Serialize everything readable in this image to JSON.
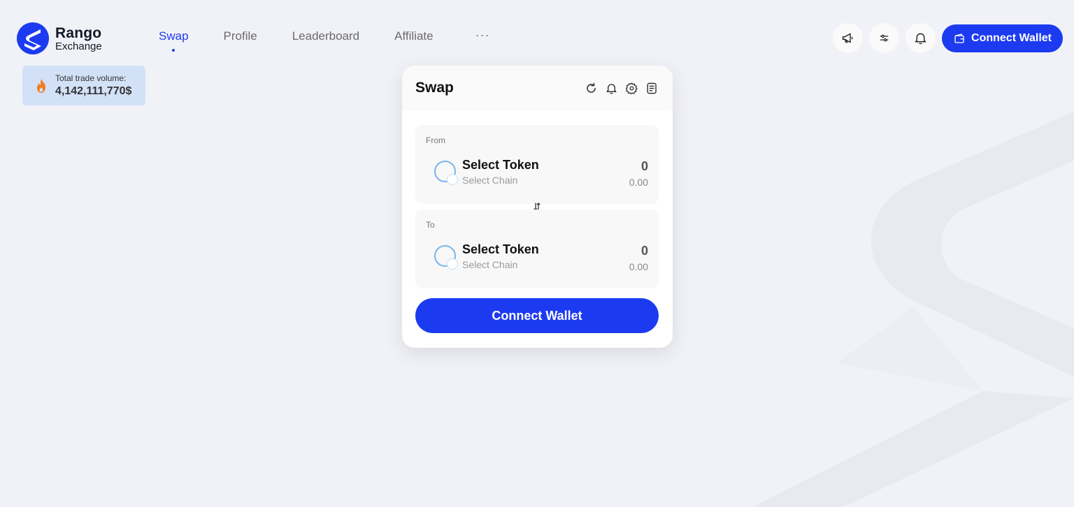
{
  "logo": {
    "name": "Rango",
    "sub": "Exchange"
  },
  "nav": {
    "items": [
      {
        "label": "Swap"
      },
      {
        "label": "Profile"
      },
      {
        "label": "Leaderboard"
      },
      {
        "label": "Affiliate"
      }
    ],
    "more": "···",
    "active": "Swap"
  },
  "header": {
    "connect_label": "Connect Wallet",
    "icons": [
      "megaphone-icon",
      "settings-sliders-icon",
      "bell-icon"
    ]
  },
  "volume": {
    "label": "Total trade volume:",
    "value": "4,142,111,770$"
  },
  "swap": {
    "title": "Swap",
    "tools": [
      "refresh-icon",
      "bell-icon",
      "gear-icon",
      "history-icon"
    ],
    "from": {
      "label": "From",
      "token": "Select Token",
      "chain": "Select Chain",
      "amount": "0",
      "usd": "0.00"
    },
    "to": {
      "label": "To",
      "token": "Select Token",
      "chain": "Select Chain",
      "amount": "0",
      "usd": "0.00"
    },
    "connect_label": "Connect Wallet"
  },
  "colors": {
    "accent": "#1c3bf1",
    "background": "#f1f2f7",
    "volume_bg": "#d3e1f7",
    "flame": "#f07c1c"
  }
}
